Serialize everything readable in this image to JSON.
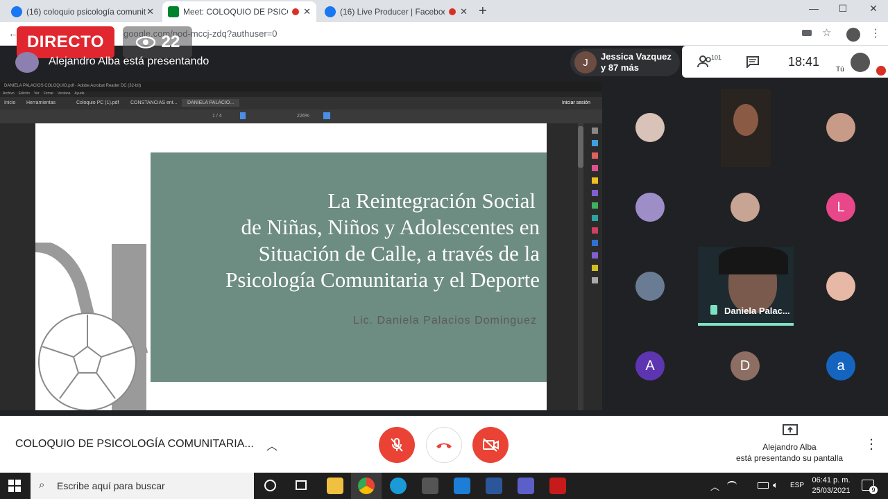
{
  "browser": {
    "tabs": [
      {
        "title": "(16) coloquio psicología comunit",
        "active": false,
        "recording": false
      },
      {
        "title": "Meet: COLOQUIO DE PSICOL",
        "active": true,
        "recording": true
      },
      {
        "title": "(16) Live Producer | Faceboo",
        "active": false,
        "recording": true
      }
    ],
    "url": "google.com/pod-mccj-zdq?authuser=0",
    "new_tab": "+",
    "window_controls": {
      "minimize": "—",
      "maximize": "☐",
      "close": "✕"
    }
  },
  "stream_overlay": {
    "live_label": "DIRECTO",
    "viewer_count": "22"
  },
  "meet": {
    "presenting_banner": "Alejandro Alba está presentando",
    "participants_chip": {
      "initial": "J",
      "line1": "Jessica Vazquez",
      "line2": "y 87 más"
    },
    "people_count": "101",
    "clock": "18:41",
    "self_label": "Tú",
    "meeting_title": "COLOQUIO DE PSICOLOGÍA COMUNITARIA...",
    "presenter_info": {
      "line1": "Alejandro Alba",
      "line2": "está presentando su pantalla"
    },
    "tiles": [
      {
        "initial": "L",
        "color": "#e8488a"
      },
      {
        "initial": "A",
        "color": "#5e35b1"
      },
      {
        "initial": "D",
        "color": "#8d6e63"
      },
      {
        "initial": "a",
        "color": "#1565c0"
      }
    ],
    "featured_name": "Daniela Palac..."
  },
  "shared_screen": {
    "window_title": "DANIELA PALACIOS COLOQUIO.pdf - Adobe Acrobat Reader DC (32-bit)",
    "menu": [
      "Archivo",
      "Edición",
      "Ver",
      "Firmar",
      "Ventana",
      "Ayuda"
    ],
    "tabs": [
      "Inicio",
      "Herramientas",
      "Coloquio PC (1).pdf",
      "CONSTANCIAS ent...",
      "DANIELA PALACIO..."
    ],
    "sign_in": "Iniciar sesión",
    "page_indicator": "1 / 4",
    "zoom": "226%",
    "slide": {
      "title_lines": [
        "La Reintegración Social",
        "de Niñas, Niños y Adolescentes en",
        "Situación de Calle, a través de la",
        "Psicología Comunitaria y el Deporte"
      ],
      "author": "Lic. Daniela Palacios Dominguez"
    }
  },
  "taskbar": {
    "search_placeholder": "Escribe aquí para buscar",
    "language": "ESP",
    "time": "06:41 p. m.",
    "date": "25/03/2021",
    "notification_count": "9"
  }
}
